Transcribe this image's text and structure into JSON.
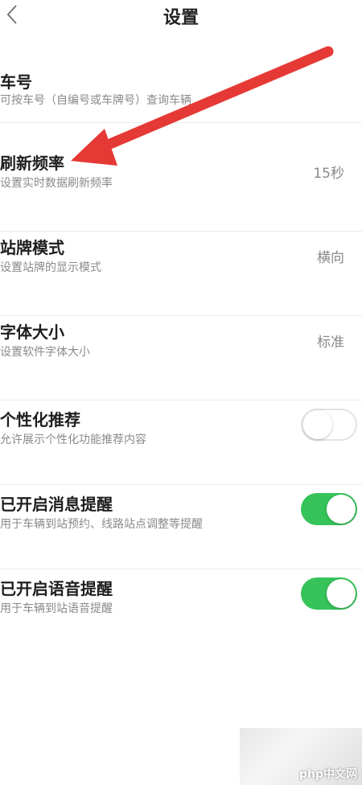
{
  "header": {
    "title": "设置",
    "back_icon": "chevron-left-icon"
  },
  "settings": [
    {
      "label": "车号",
      "desc": "可按车号（自编号或车牌号）查询车辆"
    },
    {
      "label": "刷新频率",
      "desc": "设置实时数据刷新频率",
      "value": "15秒"
    },
    {
      "label": "站牌模式",
      "desc": "设置站牌的显示模式",
      "value": "横向"
    },
    {
      "label": "字体大小",
      "desc": "设置软件字体大小",
      "value": "标准"
    },
    {
      "label": "个性化推荐",
      "desc": "允许展示个性化功能推荐内容",
      "toggle": "off"
    },
    {
      "label": "已开启消息提醒",
      "desc": "用于车辆到站预约、线路站点调整等提醒",
      "toggle": "on"
    },
    {
      "label": "已开启语音提醒",
      "desc": "用于车辆到站语音提醒",
      "toggle": "on"
    }
  ],
  "annotation": {
    "color": "#e53935",
    "icon": "red-arrow-icon"
  },
  "watermark": {
    "text": "php中文网"
  },
  "colors": {
    "toggle_on": "#36c35a",
    "toggle_off_border": "#e3e3e3"
  }
}
